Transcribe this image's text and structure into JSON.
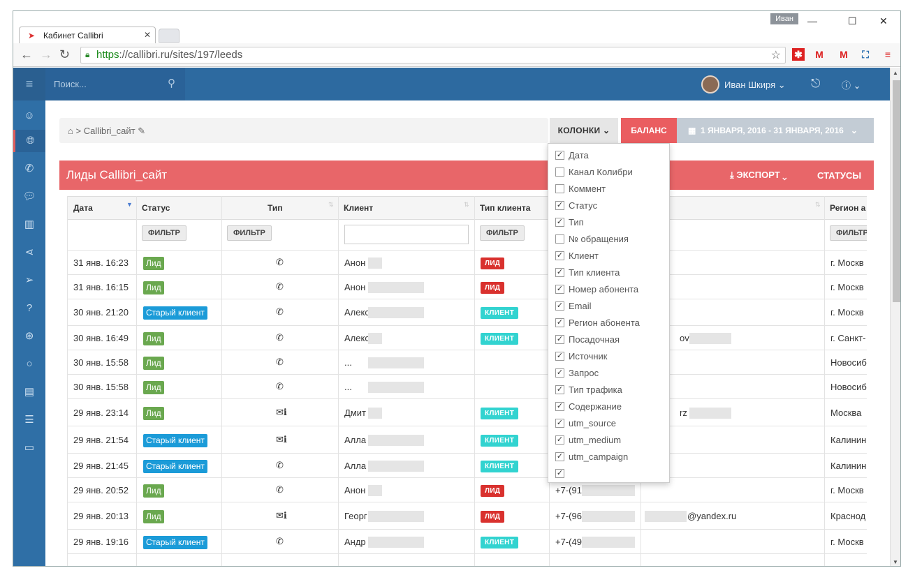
{
  "browser": {
    "tab_title": "Кабинет Callibri",
    "user_pill": "Иван",
    "url_https": "https",
    "url_rest": "://callibri.ru/sites/197/leeds"
  },
  "app": {
    "search_placeholder": "Поиск...",
    "user_name": "Иван Шкиря",
    "breadcrumb": "Callibri_сайт",
    "btn_columns": "КОЛОНКИ",
    "btn_balance": "БАЛАНС",
    "btn_date": "1 ЯНВАРЯ, 2016 - 31 ЯНВАРЯ, 2016",
    "panel_title": "Лиды Callibri_сайт",
    "export": "ЭКСПОРТ",
    "statuses": "СТАТУСЫ",
    "filter": "ФИЛЬТР"
  },
  "columns": {
    "date": "Дата",
    "status": "Статус",
    "type": "Тип",
    "client": "Клиент",
    "client_type": "Тип клиента",
    "region": "Регион а"
  },
  "dropdown": [
    {
      "label": "Дата",
      "checked": true
    },
    {
      "label": "Канал Колибри",
      "checked": false
    },
    {
      "label": "Коммент",
      "checked": false
    },
    {
      "label": "Статус",
      "checked": true
    },
    {
      "label": "Тип",
      "checked": true
    },
    {
      "label": "№ обращения",
      "checked": false
    },
    {
      "label": "Клиент",
      "checked": true
    },
    {
      "label": "Тип клиента",
      "checked": true
    },
    {
      "label": "Номер абонента",
      "checked": true
    },
    {
      "label": "Email",
      "checked": true
    },
    {
      "label": "Регион абонента",
      "checked": true
    },
    {
      "label": "Посадочная",
      "checked": true
    },
    {
      "label": "Источник",
      "checked": true
    },
    {
      "label": "Запрос",
      "checked": true
    },
    {
      "label": "Тип трафика",
      "checked": true
    },
    {
      "label": "Содержание",
      "checked": true
    },
    {
      "label": "utm_source",
      "checked": true
    },
    {
      "label": "utm_medium",
      "checked": true
    },
    {
      "label": "utm_campaign",
      "checked": true
    },
    {
      "label": "",
      "checked": true
    }
  ],
  "rows": [
    {
      "date": "31 янв. 16:23",
      "status": "Лид",
      "status_kind": "lead",
      "type": "phone",
      "client": "Анон",
      "client_type": "ЛИД",
      "ct_kind": "red",
      "phone": "",
      "email": "",
      "region": "г. Москв"
    },
    {
      "date": "31 янв. 16:15",
      "status": "Лид",
      "status_kind": "lead",
      "type": "phone",
      "client": "Анон",
      "client_type": "ЛИД",
      "ct_kind": "red",
      "phone": "",
      "email": "",
      "region": "г. Москв"
    },
    {
      "date": "30 янв. 21:20",
      "status": "Старый клиент",
      "status_kind": "old",
      "type": "phone",
      "client": "Алекс",
      "client_type": "КЛИЕНТ",
      "ct_kind": "cyan",
      "phone": "",
      "email": "",
      "region": "г. Москв"
    },
    {
      "date": "30 янв. 16:49",
      "status": "Лид",
      "status_kind": "lead",
      "type": "phone",
      "client": "Алекс",
      "client_type": "КЛИЕНТ",
      "ct_kind": "cyan",
      "phone": "",
      "email": "ov",
      "region": "г. Санкт-"
    },
    {
      "date": "30 янв. 15:58",
      "status": "Лид",
      "status_kind": "lead",
      "type": "phone",
      "client": "...",
      "client_type": "",
      "ct_kind": "",
      "phone": "",
      "email": "",
      "region": "Новосиб"
    },
    {
      "date": "30 янв. 15:58",
      "status": "Лид",
      "status_kind": "lead",
      "type": "phone",
      "client": "...",
      "client_type": "",
      "ct_kind": "",
      "phone": "",
      "email": "",
      "region": "Новосиб"
    },
    {
      "date": "29 янв. 23:14",
      "status": "Лид",
      "status_kind": "lead",
      "type": "mail",
      "client": "Дмит",
      "client_type": "КЛИЕНТ",
      "ct_kind": "cyan",
      "phone": "",
      "email": "rz",
      "region": "Москва"
    },
    {
      "date": "29 янв. 21:54",
      "status": "Старый клиент",
      "status_kind": "old",
      "type": "mail",
      "client": "Алла",
      "client_type": "КЛИЕНТ",
      "ct_kind": "cyan",
      "phone": "",
      "email": "",
      "region": "Калинин"
    },
    {
      "date": "29 янв. 21:45",
      "status": "Старый клиент",
      "status_kind": "old",
      "type": "phone",
      "client": "Алла",
      "client_type": "КЛИЕНТ",
      "ct_kind": "cyan",
      "phone": "",
      "email": "",
      "region": "Калинин"
    },
    {
      "date": "29 янв. 20:52",
      "status": "Лид",
      "status_kind": "lead",
      "type": "phone",
      "client": "Анон",
      "client_type": "ЛИД",
      "ct_kind": "red",
      "phone": "+7-(91",
      "email": "",
      "region": "г. Москв"
    },
    {
      "date": "29 янв. 20:13",
      "status": "Лид",
      "status_kind": "lead",
      "type": "mail",
      "client": "Георг",
      "client_type": "ЛИД",
      "ct_kind": "red",
      "phone": "+7-(96",
      "email": "@yandex.ru",
      "region": "Краснод"
    },
    {
      "date": "29 янв. 19:16",
      "status": "Старый клиент",
      "status_kind": "old",
      "type": "phone",
      "client": "Андр",
      "client_type": "КЛИЕНТ",
      "ct_kind": "cyan",
      "phone": "+7-(49",
      "email": "",
      "region": "г. Москв"
    }
  ]
}
